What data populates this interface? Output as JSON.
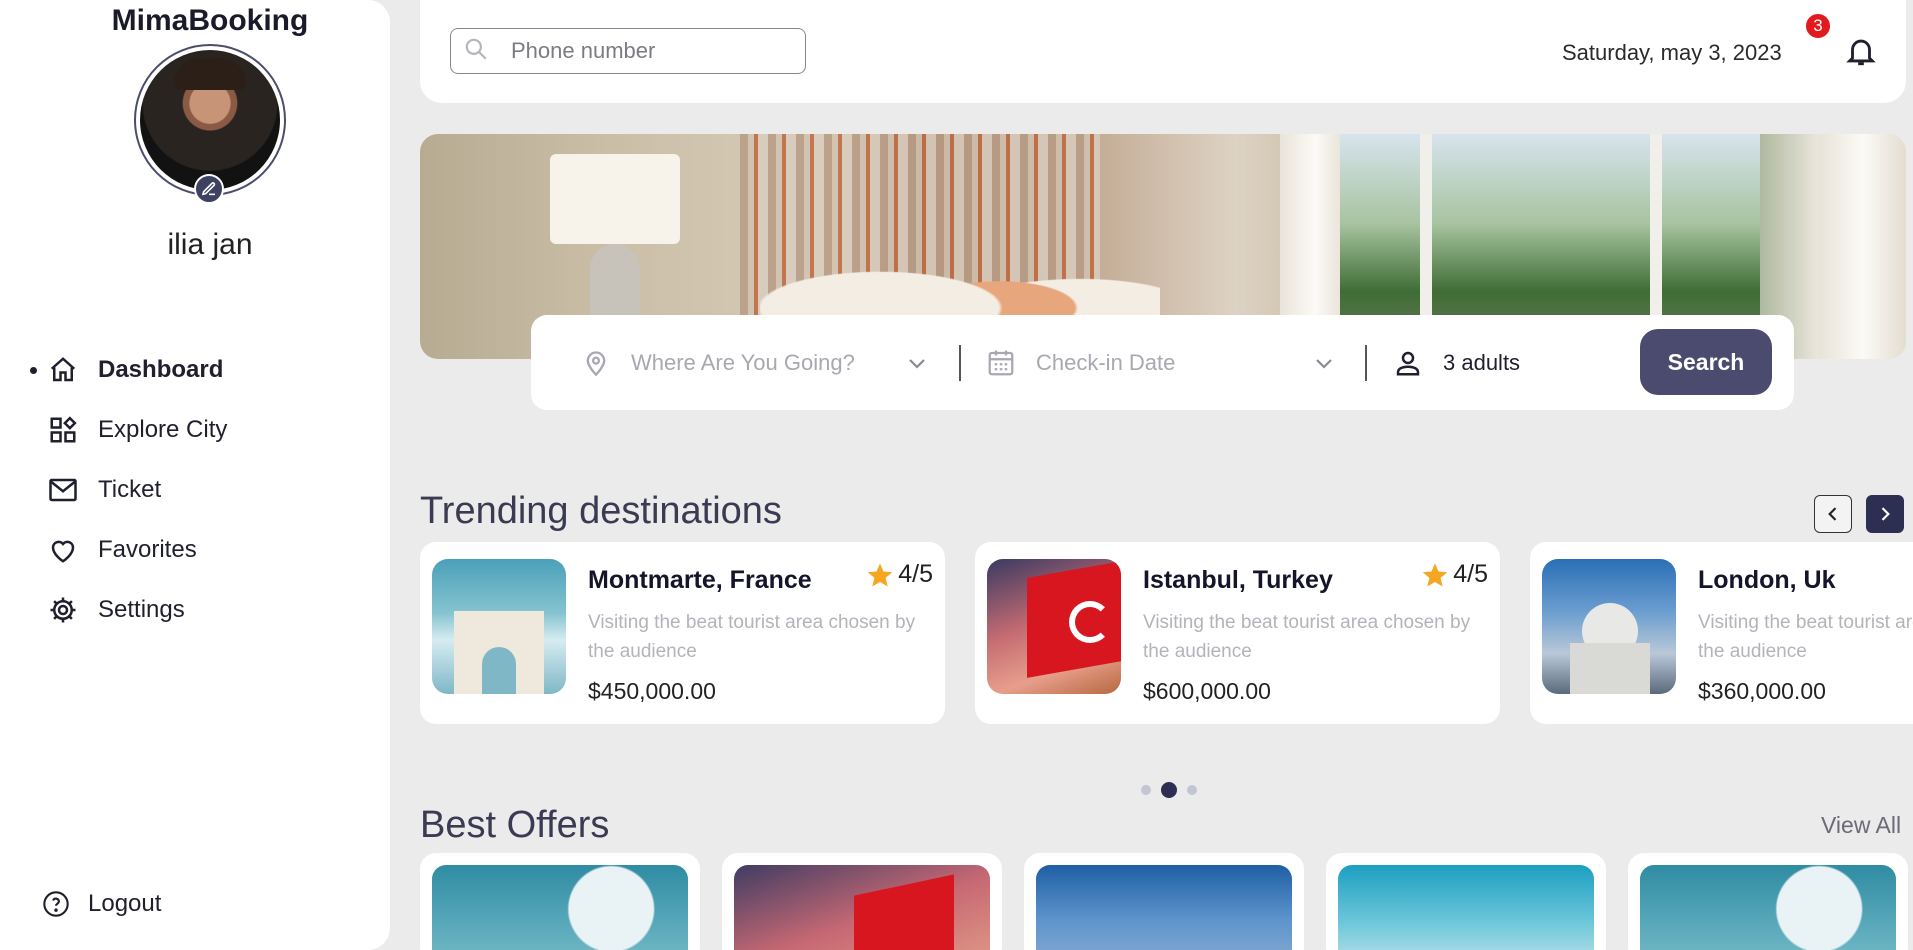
{
  "brand": "MimaBooking",
  "user": {
    "name": "ilia jan"
  },
  "nav": [
    {
      "label": "Dashboard",
      "icon": "home-icon",
      "active": true
    },
    {
      "label": "Explore City",
      "icon": "grid-icon",
      "active": false
    },
    {
      "label": "Ticket",
      "icon": "envelope-icon",
      "active": false
    },
    {
      "label": "Favorites",
      "icon": "heart-icon",
      "active": false
    },
    {
      "label": "Settings",
      "icon": "gear-icon",
      "active": false
    }
  ],
  "logout": {
    "label": "Logout",
    "icon": "question-circle-icon"
  },
  "topbar": {
    "search_placeholder": "Phone number",
    "date": "Saturday, may 3, 2023",
    "notification_count": "3"
  },
  "booking": {
    "where_placeholder": "Where Are You Going?",
    "date_placeholder": "Check-in Date",
    "guests": "3 adults",
    "search_label": "Search"
  },
  "trending": {
    "title": "Trending destinations",
    "cards": [
      {
        "name": "Montmarte, France",
        "rating": "4/5",
        "desc": "Visiting the beat tourist area chosen by the audience",
        "price": "$450,000.00"
      },
      {
        "name": "Istanbul, Turkey",
        "rating": "4/5",
        "desc": "Visiting the beat tourist area chosen by the audience",
        "price": "$600,000.00"
      },
      {
        "name": "London, Uk",
        "rating": "",
        "desc": "Visiting the beat tourist area chosen by the audience",
        "price": "$360,000.00"
      }
    ],
    "carousel_active_index": 1
  },
  "offers": {
    "title": "Best Offers",
    "view_all": "View All"
  },
  "colors": {
    "accent": "#4a4b6e",
    "dark_accent": "#2d2f52",
    "badge": "#e2191d",
    "star": "#f5a623",
    "background": "#ebebeb"
  }
}
